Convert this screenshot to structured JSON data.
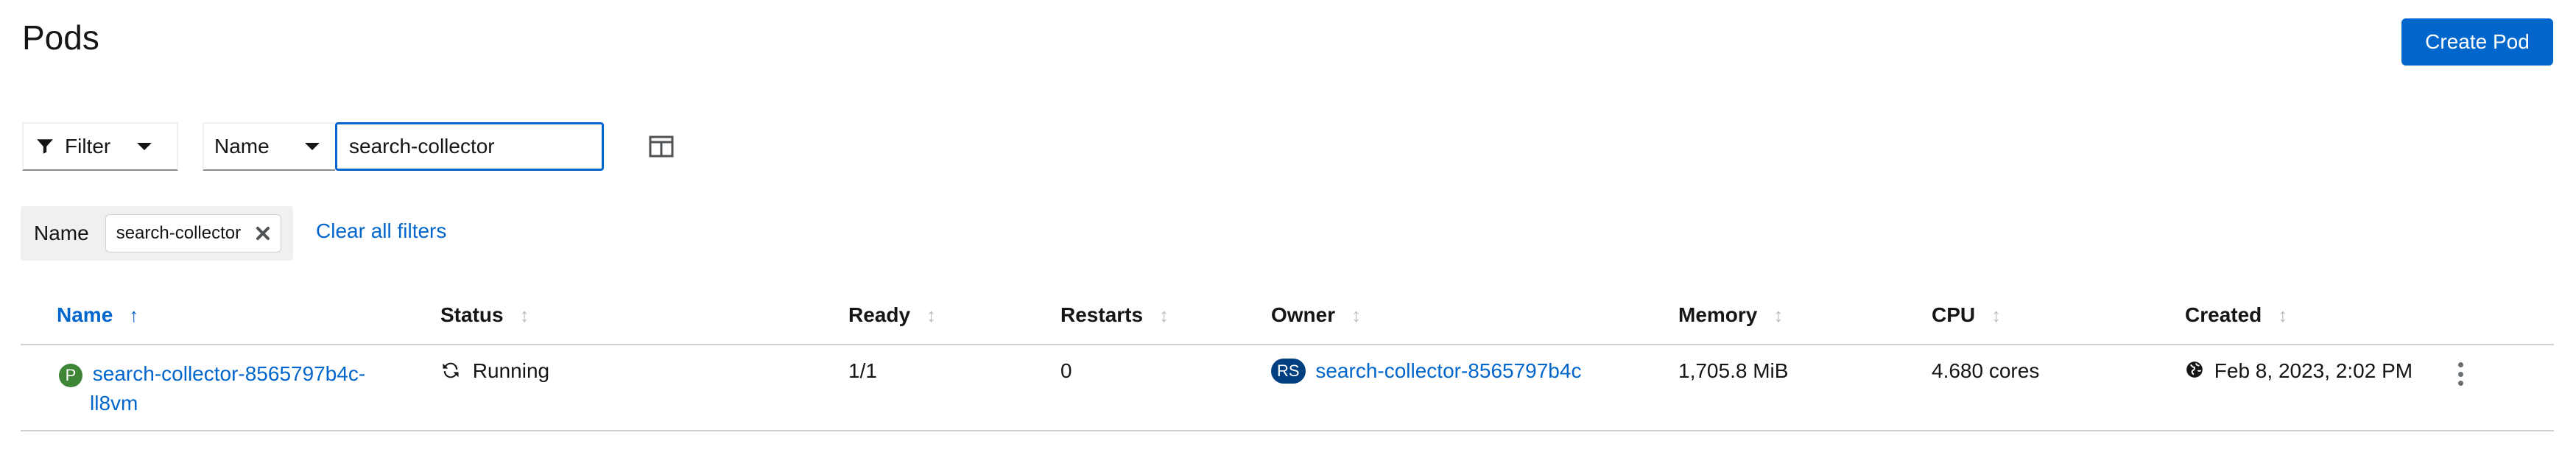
{
  "header": {
    "title": "Pods",
    "create_button": "Create Pod"
  },
  "toolbar": {
    "filter_label": "Filter",
    "name_select": "Name",
    "search_value": "search-collector"
  },
  "chips": {
    "category": "Name",
    "chip_value": "search-collector",
    "clear_all": "Clear all filters"
  },
  "table": {
    "columns": [
      "Name",
      "Status",
      "Ready",
      "Restarts",
      "Owner",
      "Memory",
      "CPU",
      "Created"
    ],
    "rows": [
      {
        "name_badge": "P",
        "name_line1": "search-collector-8565797b4c-",
        "name_line2": "ll8vm",
        "status": "Running",
        "ready": "1/1",
        "restarts": "0",
        "owner_badge": "RS",
        "owner": "search-collector-8565797b4c",
        "memory": "1,705.8 MiB",
        "cpu": "4.680 cores",
        "created": "Feb 8, 2023, 2:02 PM"
      }
    ]
  },
  "colors": {
    "link": "#0066cc",
    "badge": "#004080",
    "primary_button": "#0066cc",
    "pod_badge": "#3e8635"
  }
}
